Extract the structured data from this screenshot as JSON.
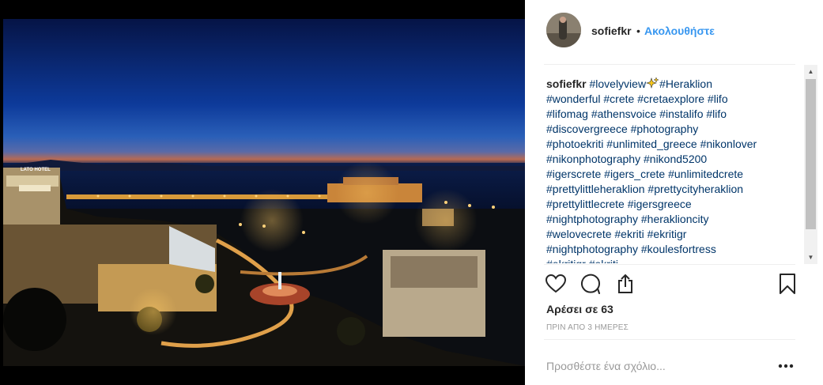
{
  "post": {
    "username": "sofiefkr",
    "separator": "•",
    "follow_label": "Ακολουθήστε",
    "caption": {
      "username": "sofiefkr",
      "lines": [
        [
          "#lovelyview",
          "#Heraklion"
        ],
        [
          "#wonderful",
          "#crete",
          "#cretaexplore",
          "#lifo"
        ],
        [
          "#lifomag",
          "#athensvoice",
          "#instalifo",
          "#lifo"
        ],
        [
          "#discovergreece",
          "#photography"
        ],
        [
          "#photoekriti",
          "#unlimited_greece",
          "#nikonlover"
        ],
        [
          "#nikonphotography",
          "#nikond5200"
        ],
        [
          "#igerscrete",
          "#igers_crete",
          "#unlimitedcrete"
        ],
        [
          "#prettylittleheraklion",
          "#prettycityheraklion"
        ],
        [
          "#prettylittlecrete",
          "#igersgreece"
        ],
        [
          "#nightphotography",
          "#heraklioncity"
        ],
        [
          "#welovecrete",
          "#ekriti",
          "#ekritigr"
        ],
        [
          "#nightphotography",
          "#koulesfortress"
        ],
        [
          "#ekritigr",
          "#ekriti"
        ]
      ],
      "emoji": "sparkle-emoji"
    },
    "likes_label": "Αρέσει σε 63",
    "time_label": "ΠΡΙΝ ΑΠΟ 3 ΗΜΕΡΕΣ",
    "comment_placeholder": "Προσθέστε ένα σχόλιο...",
    "more_label": "•••"
  },
  "photo": {
    "overlay_sign": "LATO HOTEL",
    "description_icon": "night-harbor-photo"
  },
  "colors": {
    "link": "#3897f0",
    "hashtag": "#003569",
    "text": "#262626",
    "muted": "#999999",
    "divider": "#efefef"
  },
  "icons": {
    "like": "heart-icon",
    "comment": "comment-icon",
    "share": "share-icon",
    "save": "bookmark-icon",
    "options": "more-icon"
  }
}
